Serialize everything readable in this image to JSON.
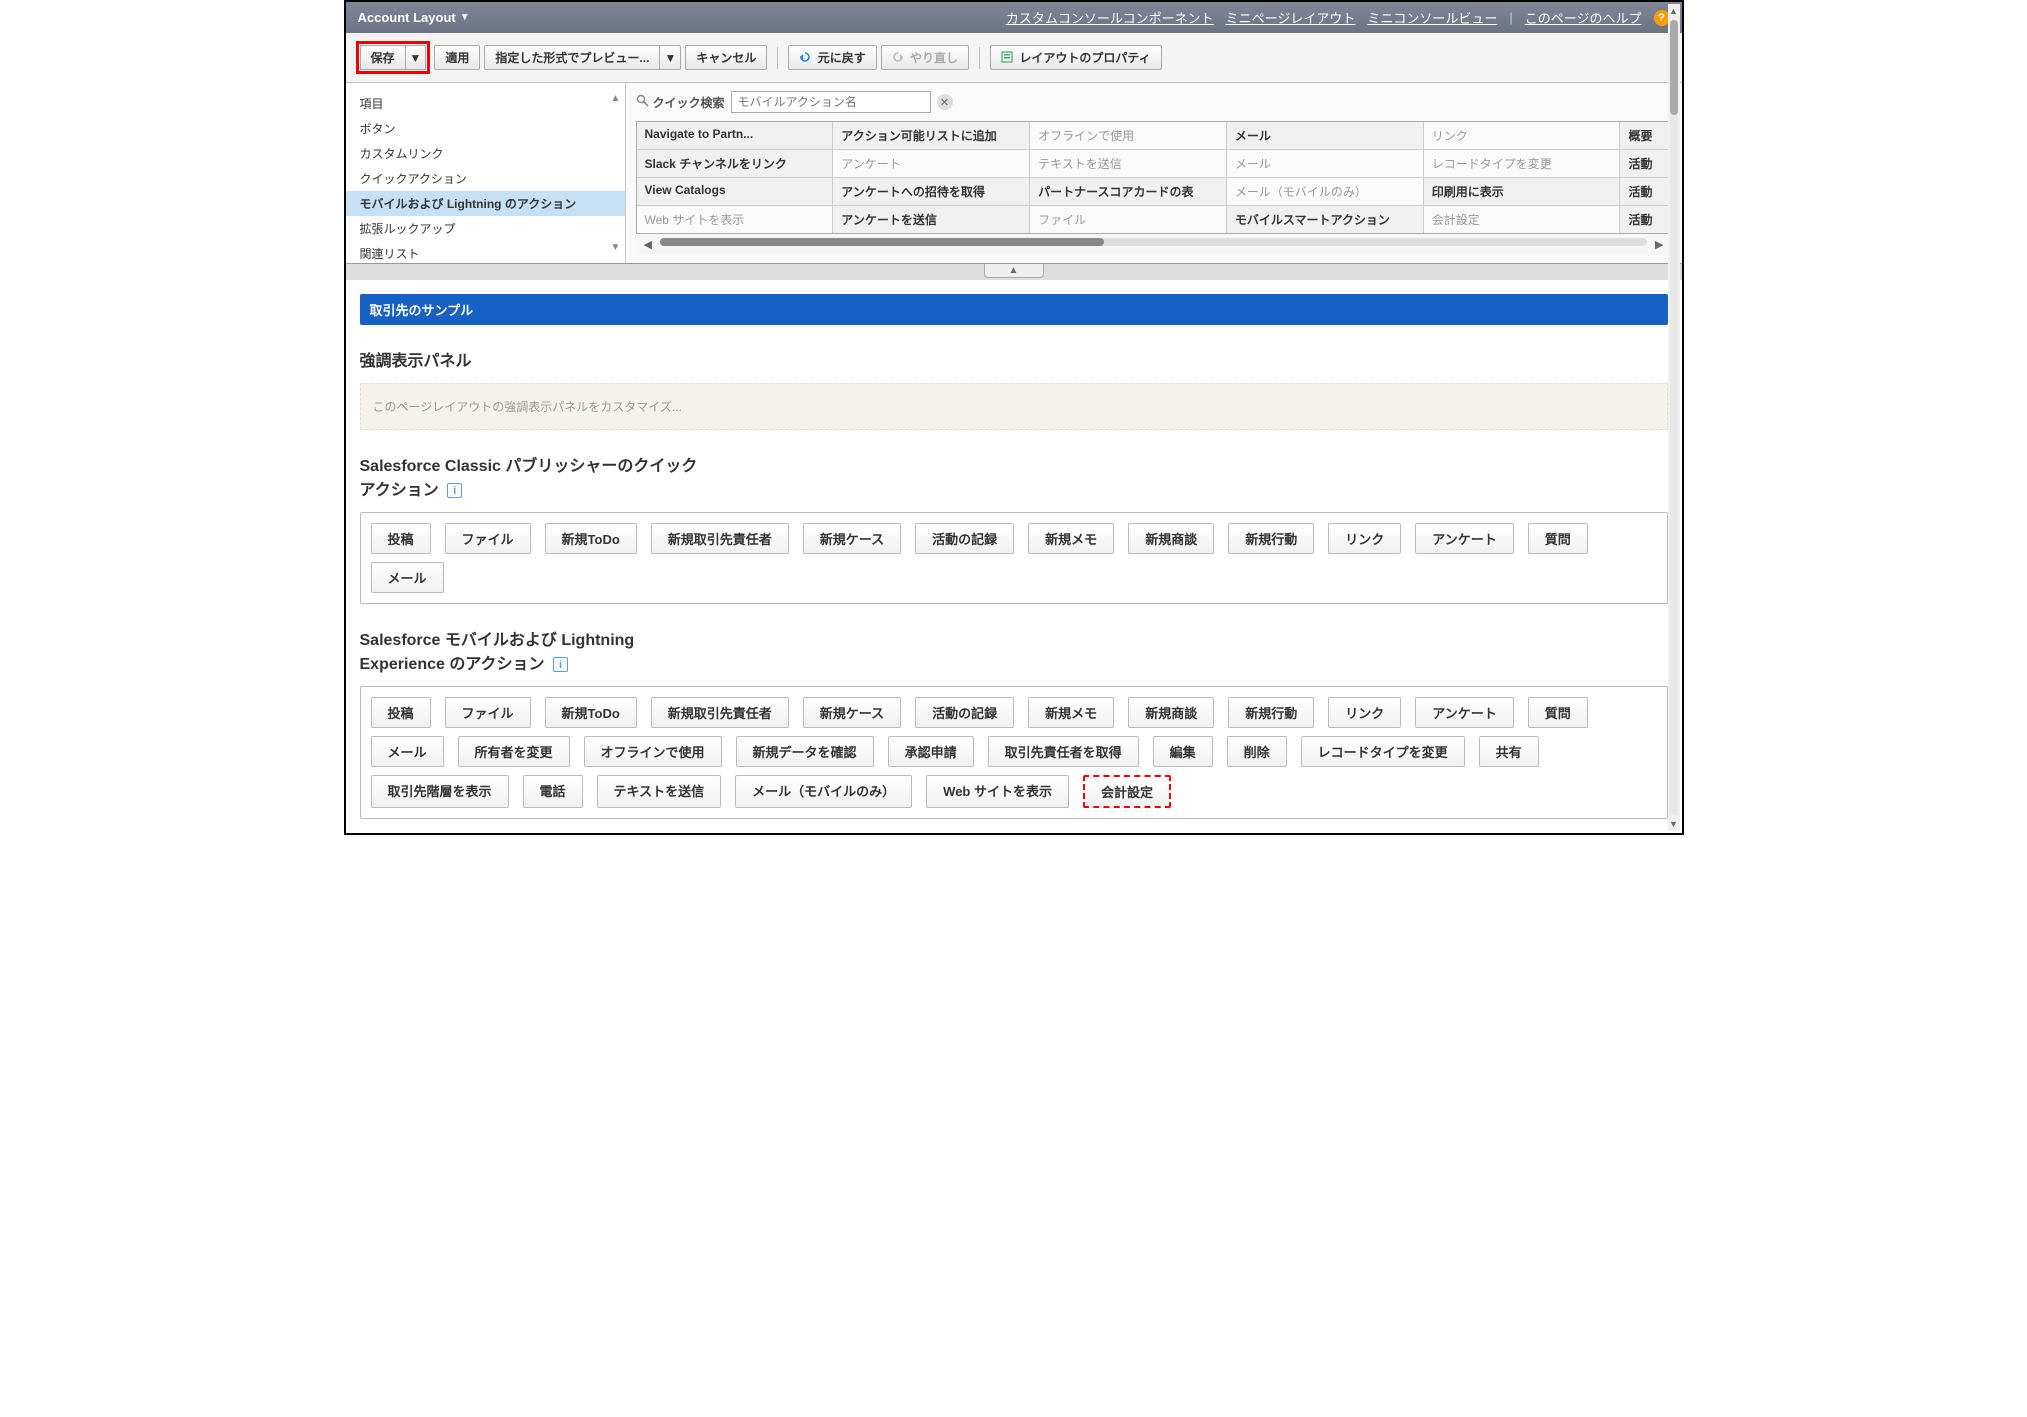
{
  "header": {
    "title": "Account Layout",
    "links": [
      "カスタムコンソールコンポーネント",
      "ミニページレイアウト",
      "ミニコンソールビュー",
      "このページのヘルプ"
    ]
  },
  "toolbar": {
    "save": "保存",
    "apply": "適用",
    "preview": "指定した形式でプレビュー...",
    "cancel": "キャンセル",
    "undo": "元に戻す",
    "redo": "やり直し",
    "props": "レイアウトのプロパティ"
  },
  "sidebar": {
    "items": [
      "項目",
      "ボタン",
      "カスタムリンク",
      "クイックアクション",
      "モバイルおよび Lightning のアクション",
      "拡張ルックアップ",
      "関連リスト"
    ],
    "selected_index": 4
  },
  "quickfind": {
    "label": "クイック検索",
    "placeholder": "モバイルアクション名"
  },
  "grid": {
    "rows": [
      [
        {
          "t": "Navigate to Partn...",
          "dim": false
        },
        {
          "t": "アクション可能リストに追加",
          "dim": false
        },
        {
          "t": "オフラインで使用",
          "dim": true
        },
        {
          "t": "メール",
          "dim": false
        },
        {
          "t": "リンク",
          "dim": true
        },
        {
          "t": "概要",
          "dim": false
        }
      ],
      [
        {
          "t": "Slack チャンネルをリンク",
          "dim": false
        },
        {
          "t": "アンケート",
          "dim": true
        },
        {
          "t": "テキストを送信",
          "dim": true
        },
        {
          "t": "メール",
          "dim": true
        },
        {
          "t": "レコードタイプを変更",
          "dim": true
        },
        {
          "t": "活動",
          "dim": false
        }
      ],
      [
        {
          "t": "View Catalogs",
          "dim": false
        },
        {
          "t": "アンケートへの招待を取得",
          "dim": false
        },
        {
          "t": "パートナースコアカードの表",
          "dim": false
        },
        {
          "t": "メール（モバイルのみ）",
          "dim": true
        },
        {
          "t": "印刷用に表示",
          "dim": false
        },
        {
          "t": "活動",
          "dim": false
        }
      ],
      [
        {
          "t": "Web サイトを表示",
          "dim": true
        },
        {
          "t": "アンケートを送信",
          "dim": false
        },
        {
          "t": "ファイル",
          "dim": true
        },
        {
          "t": "モバイルスマートアクション",
          "dim": false
        },
        {
          "t": "会計設定",
          "dim": true
        },
        {
          "t": "活動",
          "dim": false
        }
      ]
    ]
  },
  "canvas": {
    "sample_header": "取引先のサンプル",
    "highlight_title": "強調表示パネル",
    "highlight_placeholder": "このページレイアウトの強調表示パネルをカスタマイズ...",
    "classic_title_1": "Salesforce Classic パブリッシャーのクイック",
    "classic_title_2": "アクション",
    "classic_actions": [
      "投稿",
      "ファイル",
      "新規ToDo",
      "新規取引先責任者",
      "新規ケース",
      "活動の記録",
      "新規メモ",
      "新規商談",
      "新規行動",
      "リンク",
      "アンケート",
      "質問",
      "メール"
    ],
    "mobile_title_1": "Salesforce モバイルおよび Lightning",
    "mobile_title_2": "Experience のアクション",
    "mobile_actions": [
      {
        "t": "投稿",
        "h": false
      },
      {
        "t": "ファイル",
        "h": false
      },
      {
        "t": "新規ToDo",
        "h": false
      },
      {
        "t": "新規取引先責任者",
        "h": false
      },
      {
        "t": "新規ケース",
        "h": false
      },
      {
        "t": "活動の記録",
        "h": false
      },
      {
        "t": "新規メモ",
        "h": false
      },
      {
        "t": "新規商談",
        "h": false
      },
      {
        "t": "新規行動",
        "h": false
      },
      {
        "t": "リンク",
        "h": false
      },
      {
        "t": "アンケート",
        "h": false
      },
      {
        "t": "質問",
        "h": false
      },
      {
        "t": "メール",
        "h": false
      },
      {
        "t": "所有者を変更",
        "h": false
      },
      {
        "t": "オフラインで使用",
        "h": false
      },
      {
        "t": "新規データを確認",
        "h": false
      },
      {
        "t": "承認申請",
        "h": false
      },
      {
        "t": "取引先責任者を取得",
        "h": false
      },
      {
        "t": "編集",
        "h": false
      },
      {
        "t": "削除",
        "h": false
      },
      {
        "t": "レコードタイプを変更",
        "h": false
      },
      {
        "t": "共有",
        "h": false
      },
      {
        "t": "取引先階層を表示",
        "h": false
      },
      {
        "t": "電話",
        "h": false
      },
      {
        "t": "テキストを送信",
        "h": false
      },
      {
        "t": "メール（モバイルのみ）",
        "h": false
      },
      {
        "t": "Web サイトを表示",
        "h": false
      },
      {
        "t": "会計設定",
        "h": true
      }
    ]
  }
}
